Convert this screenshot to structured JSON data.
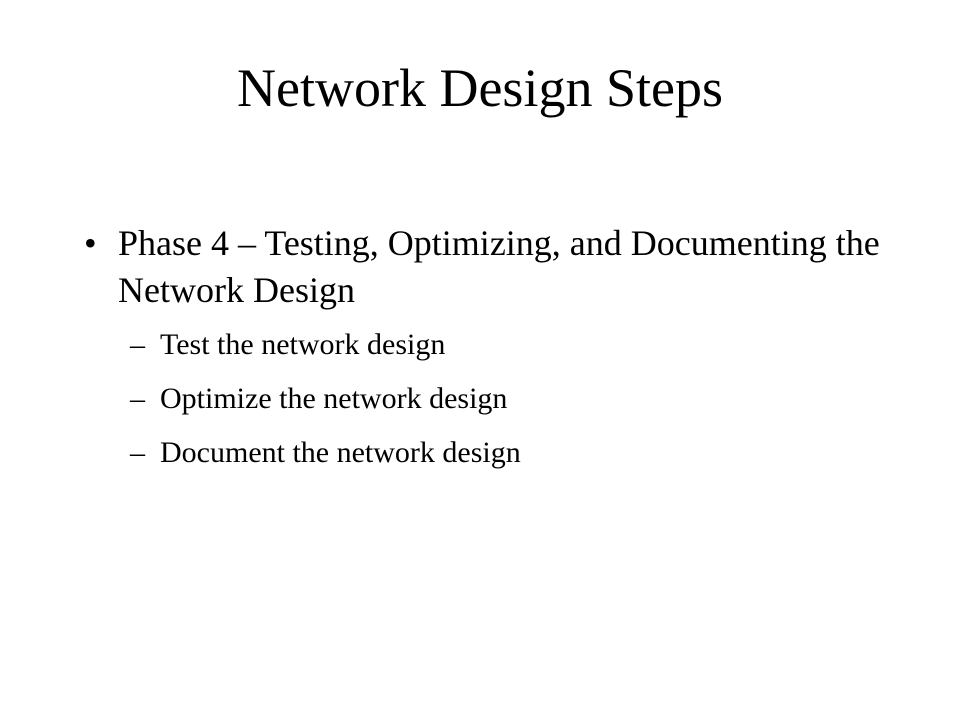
{
  "slide": {
    "title": "Network Design Steps",
    "bullets": [
      {
        "marker": "•",
        "text": "Phase 4 – Testing, Optimizing, and Documenting the Network Design",
        "sub_marker": "–",
        "sub_items": [
          "Test the network design",
          "Optimize the network design",
          "Document the network design"
        ]
      }
    ]
  }
}
